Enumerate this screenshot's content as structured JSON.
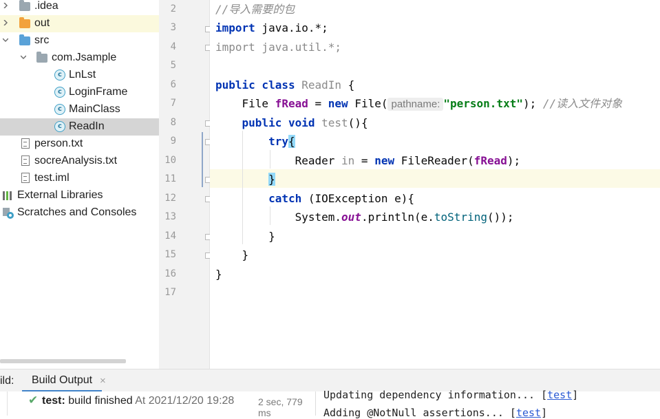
{
  "project_tree": {
    "items": [
      {
        "label": ".idea",
        "icon": "folder-icon"
      },
      {
        "label": "out",
        "icon": "folder-icon"
      },
      {
        "label": "src",
        "icon": "folder-icon"
      },
      {
        "label": "com.Jsample",
        "icon": "package-icon"
      },
      {
        "label": "LnLst",
        "icon": "class-icon"
      },
      {
        "label": "LoginFrame",
        "icon": "class-icon"
      },
      {
        "label": "MainClass",
        "icon": "class-icon"
      },
      {
        "label": "ReadIn",
        "icon": "class-icon"
      },
      {
        "label": "person.txt",
        "icon": "text-file-icon"
      },
      {
        "label": "socreAnalysis.txt",
        "icon": "text-file-icon"
      },
      {
        "label": "test.iml",
        "icon": "iml-file-icon"
      },
      {
        "label": "External Libraries",
        "icon": "libraries-icon"
      },
      {
        "label": "Scratches and Consoles",
        "icon": "scratches-icon"
      }
    ],
    "colors": {
      "folder": "#9aa7b0",
      "folder_out": "#f2a23c",
      "folder_src": "#5aa2d8",
      "selected_row": "#d5d5d5",
      "highlight_row": "#fbf9dd"
    }
  },
  "editor": {
    "line_numbers": [
      "2",
      "3",
      "4",
      "5",
      "6",
      "7",
      "8",
      "9",
      "10",
      "11",
      "12",
      "13",
      "14",
      "15",
      "16",
      "17"
    ],
    "code": {
      "l2_comment": "//导入需要的包",
      "l3_kw": "import",
      "l3_rest": " java.io.*;",
      "l4_kw": "import",
      "l4_rest": " java.util.*;",
      "l6_kw": "public class",
      "l6_name": " ReadIn",
      "l6_rest": " {",
      "l7_a": "    File ",
      "l7_field": "fRead",
      "l7_b": " = ",
      "l7_kw": "new",
      "l7_c": " File(",
      "l7_hint": "pathname:",
      "l7_str": "\"person.txt\"",
      "l7_d": "); ",
      "l7_comment": "//读入文件对象",
      "l8_a": "    ",
      "l8_kw": "public void",
      "l8_name": " test",
      "l8_rest": "(){",
      "l9_a": "        ",
      "l9_kw": "try",
      "l9_brace": "{",
      "l10_a": "            Reader ",
      "l10_var": "in",
      "l10_b": " = ",
      "l10_kw": "new",
      "l10_c": " FileReader(",
      "l10_field": "fRead",
      "l10_d": ");",
      "l11_a": "        ",
      "l11_brace": "}",
      "l12_a": "        ",
      "l12_kw": "catch",
      "l12_rest": " (IOException e){",
      "l13_a": "            System.",
      "l13_static": "out",
      "l13_b": ".println(e.",
      "l13_method": "toString",
      "l13_c": "());",
      "l14": "        }",
      "l15": "    }",
      "l16": "}"
    }
  },
  "build_panel": {
    "title_prefix": "ild:",
    "tab_label": "Build Output",
    "close_glyph": "×",
    "status_check": "✔",
    "status_bold": "test:",
    "status_text": " build finished",
    "status_time": " At 2021/12/20 19:28",
    "duration": "2 sec, 779 ms",
    "console_line1": "Updating dependency information... [",
    "console_link1": "test",
    "console_line1_end": "]",
    "console_line2": "Adding @NotNull assertions... [",
    "console_link2": "test",
    "console_line2_end": "]"
  }
}
